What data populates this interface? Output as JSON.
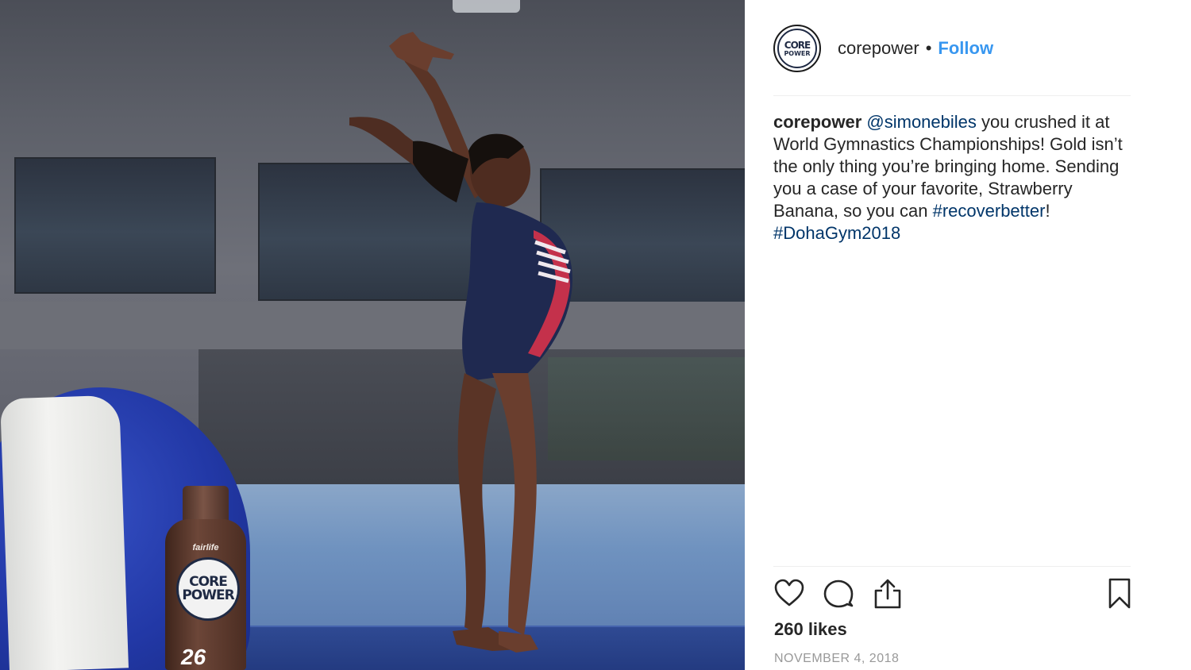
{
  "post": {
    "image": {
      "description_icon": "gymnast-photo",
      "bottle_brand": "fairlife",
      "bottle_logo_line1": "CORE",
      "bottle_logo_line2": "POWER",
      "bottle_grams": "26"
    },
    "header": {
      "avatar_line1": "CORE",
      "avatar_line2": "POWER",
      "username": "corepower",
      "separator": "•",
      "follow_label": "Follow"
    },
    "caption": {
      "username": "corepower",
      "mention": "@simonebiles",
      "text": " you crushed it at World Gymnastics Championships! Gold isn’t the only thing you’re bringing home. Sending you a case of your favorite, Strawberry Banana, so you can ",
      "hashtag1": "#recoverbetter",
      "text_between": "! ",
      "hashtag2": "#DohaGym2018"
    },
    "actions": {
      "like_icon": "heart-icon",
      "comment_icon": "comment-icon",
      "share_icon": "share-icon",
      "save_icon": "bookmark-icon"
    },
    "likes": "260 likes",
    "date": "NOVEMBER 4, 2018"
  },
  "colors": {
    "follow": "#3897f0",
    "link": "#003569",
    "text": "#262626",
    "muted": "#999999"
  }
}
